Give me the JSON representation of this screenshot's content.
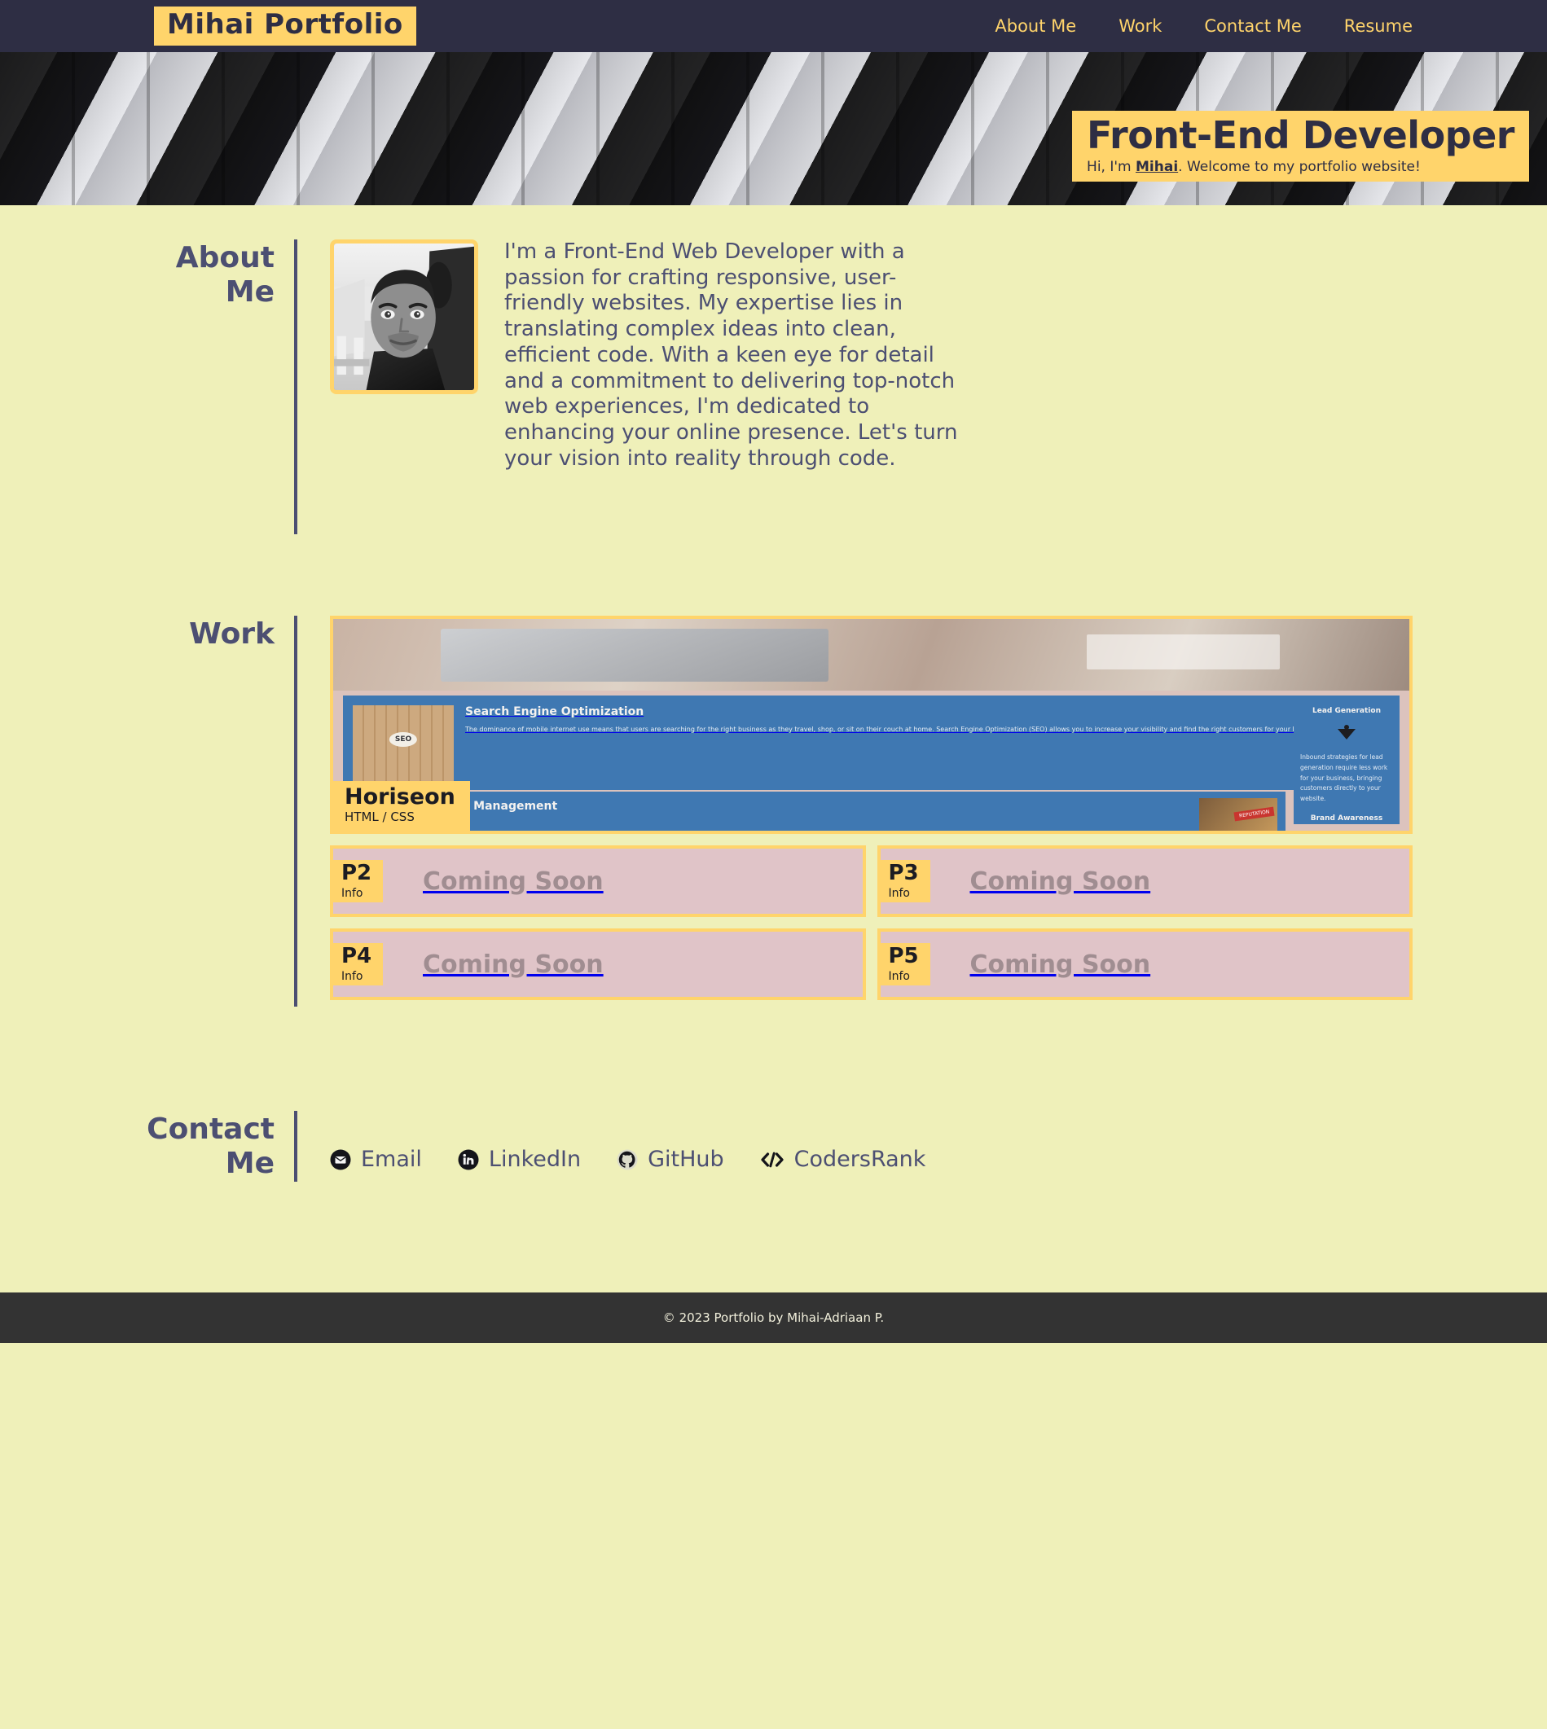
{
  "nav": {
    "brand": "Mihai Portfolio",
    "links": [
      {
        "label": "About Me"
      },
      {
        "label": "Work"
      },
      {
        "label": "Contact Me"
      },
      {
        "label": "Resume"
      }
    ]
  },
  "hero": {
    "title": "Front-End Developer",
    "greeting_before": "Hi, I'm ",
    "greeting_name": "Mihai",
    "greeting_after": ". Welcome to my portfolio website!"
  },
  "about": {
    "title": "About Me",
    "avatar_alt": "profile-photo",
    "paragraph": "I'm a Front-End Web Developer with a passion for crafting responsive, user-friendly websites. My expertise lies in translating complex ideas into clean, efficient code. With a keen eye for detail and a commitment to delivering top-notch web experiences, I'm dedicated to enhancing your online presence. Let's turn your vision into reality through code."
  },
  "work": {
    "title": "Work",
    "featured": {
      "name": "Horiseon",
      "tech": "HTML / CSS",
      "preview": {
        "seo_heading": "Search Engine Optimization",
        "seo_body": "The dominance of mobile internet use means that users are searching for the right business as they travel, shop, or sit on their couch at home. Search Engine Optimization (SEO) allows you to increase your visibility and find the right customers for your business.",
        "lead_heading": "Lead Generation",
        "lead_body": "Inbound strategies for lead generation require less work for your business, bringing customers directly to your website.",
        "brand_heading": "Brand Awareness",
        "reputation_heading": "Online Reputation Management"
      }
    },
    "placeholders": [
      {
        "tag": "P2",
        "sub": "Info",
        "label": "Coming Soon"
      },
      {
        "tag": "P3",
        "sub": "Info",
        "label": "Coming Soon"
      },
      {
        "tag": "P4",
        "sub": "Info",
        "label": "Coming Soon"
      },
      {
        "tag": "P5",
        "sub": "Info",
        "label": "Coming Soon"
      }
    ]
  },
  "contact": {
    "title": "Contact Me",
    "links": [
      {
        "label": "Email",
        "icon": "email-icon"
      },
      {
        "label": "LinkedIn",
        "icon": "linkedin-icon"
      },
      {
        "label": "GitHub",
        "icon": "github-icon"
      },
      {
        "label": "CodersRank",
        "icon": "code-brackets-icon"
      }
    ]
  },
  "footer": {
    "text": "© 2023 Portfolio by Mihai-Adriaan P."
  },
  "colors": {
    "navy": "#2e2e44",
    "yellow": "#ffd46b",
    "page_bg": "#eff0b9",
    "text": "#4c4f72",
    "placeholder_bg": "#e0c4c8",
    "footer_bg": "#333333"
  }
}
